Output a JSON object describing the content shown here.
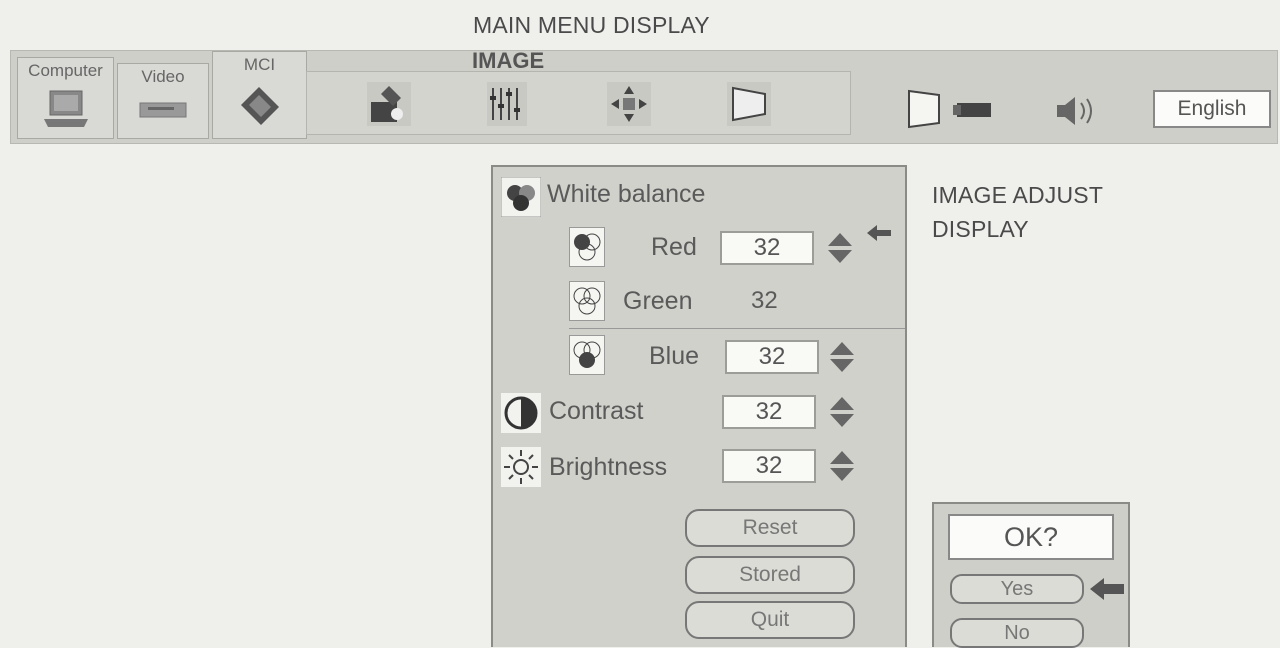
{
  "captions": {
    "main_menu": "MAIN MENU DISPLAY",
    "image_adjust_line1": "IMAGE ADJUST",
    "image_adjust_line2": "DISPLAY"
  },
  "menubar": {
    "tabs": [
      {
        "label": "Computer",
        "icon": "laptop-icon"
      },
      {
        "label": "Video",
        "icon": "vcr-icon"
      },
      {
        "label": "MCI",
        "icon": "mci-card-icon"
      }
    ],
    "image_group_title": "IMAGE",
    "image_tools": [
      "image-adjust-icon",
      "image-level-icon",
      "screen-position-icon",
      "keystone-icon"
    ],
    "right_tools": [
      "screen-icon",
      "projector-icon",
      "speaker-icon"
    ],
    "language": "English"
  },
  "image_adjust": {
    "white_balance_label": "White balance",
    "red": {
      "label": "Red",
      "value": "32"
    },
    "green": {
      "label": "Green",
      "value": "32"
    },
    "blue": {
      "label": "Blue",
      "value": "32"
    },
    "contrast": {
      "label": "Contrast",
      "value": "32"
    },
    "brightness": {
      "label": "Brightness",
      "value": "32"
    },
    "buttons": {
      "reset": "Reset",
      "stored": "Stored",
      "quit": "Quit"
    }
  },
  "confirm": {
    "title": "OK?",
    "yes": "Yes",
    "no": "No"
  }
}
